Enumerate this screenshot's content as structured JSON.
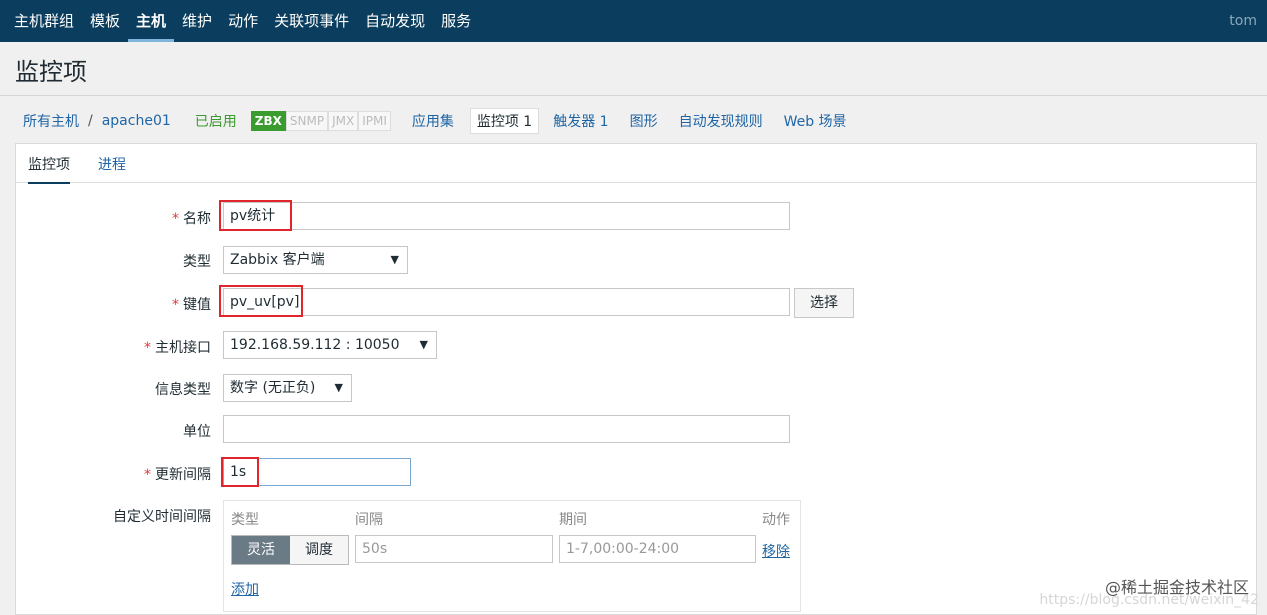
{
  "nav": {
    "items": [
      "主机群组",
      "模板",
      "主机",
      "维护",
      "动作",
      "关联项事件",
      "自动发现",
      "服务"
    ],
    "active_index": 2,
    "user": "tom"
  },
  "page": {
    "title": "监控项"
  },
  "breadcrumb": {
    "all_hosts": "所有主机",
    "separator": "/",
    "host": "apache01",
    "status": "已启用",
    "badges": [
      "ZBX",
      "SNMP",
      "JMX",
      "IPMI"
    ],
    "links": [
      "应用集",
      "监控项 1",
      "触发器 1",
      "图形",
      "自动发现规则",
      "Web 场景"
    ]
  },
  "tabs": [
    "监控项",
    "进程"
  ],
  "form": {
    "name_label": "名称",
    "name_value": "pv统计",
    "type_label": "类型",
    "type_value": "Zabbix 客户端",
    "key_label": "键值",
    "key_value": "pv_uv[pv]",
    "key_button": "选择",
    "iface_label": "主机接口",
    "iface_value": "192.168.59.112 : 10050",
    "info_type_label": "信息类型",
    "info_type_value": "数字 (无正负)",
    "unit_label": "单位",
    "unit_value": "",
    "interval_label": "更新间隔",
    "interval_value": "1s",
    "custom_label": "自定义时间间隔",
    "custom": {
      "headers": [
        "类型",
        "间隔",
        "期间",
        "动作"
      ],
      "seg": [
        "灵活",
        "调度"
      ],
      "interval_placeholder": "50s",
      "period_placeholder": "1-7,00:00-24:00",
      "remove": "移除",
      "add": "添加"
    }
  },
  "watermark": "@稀土掘金技术社区",
  "watermark_url": "https://blog.csdn.net/weixin_42"
}
